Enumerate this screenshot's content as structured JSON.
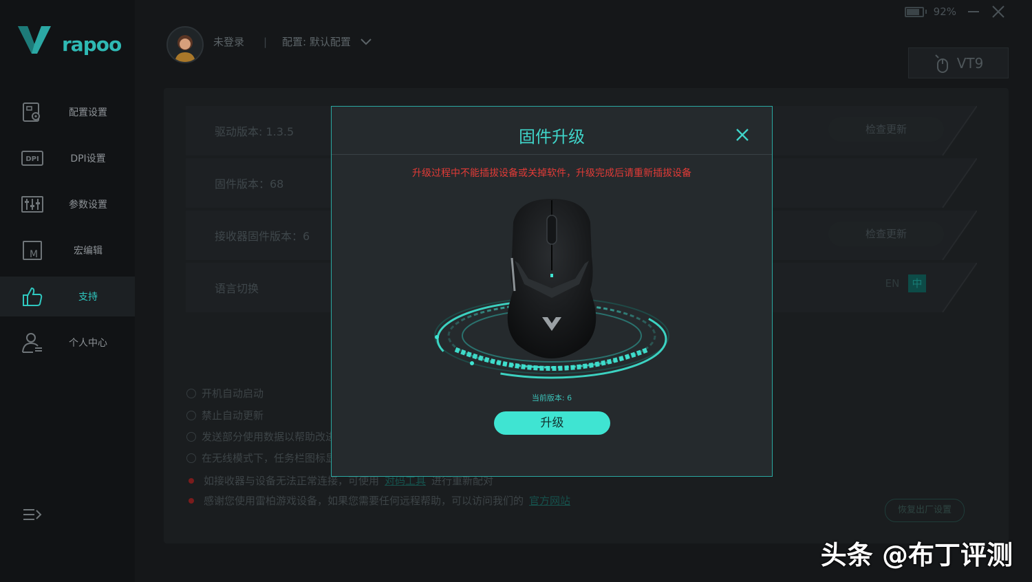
{
  "brand": {
    "logo_text": "rapoo"
  },
  "sidebar": {
    "items": [
      {
        "label": "配置设置",
        "icon": "profile-settings-icon"
      },
      {
        "label": "DPI设置",
        "icon": "dpi-icon"
      },
      {
        "label": "参数设置",
        "icon": "sliders-icon"
      },
      {
        "label": "宏编辑",
        "icon": "macro-icon"
      },
      {
        "label": "支持",
        "icon": "thumbs-up-icon",
        "active": true
      },
      {
        "label": "个人中心",
        "icon": "user-icon"
      }
    ]
  },
  "header": {
    "user": "未登录",
    "separator": "|",
    "profile": "配置: 默认配置",
    "battery": "92%",
    "battery_level": 0.92,
    "device": "VT9"
  },
  "support": {
    "driver_version": "驱动版本: 1.3.5",
    "firmware_version": "固件版本：68",
    "receiver_version": "接收器固件版本：6",
    "language_label": "语言切换",
    "check_update": "检查更新",
    "lang_en": "EN",
    "lang_zh": "中",
    "options": [
      "开机自动启动",
      "禁止自动更新",
      "发送部分使用数据以帮助改进软件",
      "在无线模式下，任务栏图标显示电量"
    ],
    "notes": [
      {
        "text": "如接收器与设备无法正常连接，可使用",
        "link": "对码工具",
        "tail": "进行重新配对"
      },
      {
        "text": "感谢您使用雷柏游戏设备，如果您需要任何远程帮助，可以访问我们的",
        "link": "官方网站",
        "tail": ""
      }
    ],
    "reset": "恢复出厂设置"
  },
  "modal": {
    "title": "固件升级",
    "warning": "升级过程中不能插拔设备或关掉软件，升级完成后请重新插拔设备",
    "current_version": "当前版本: 6",
    "upgrade": "升级"
  },
  "watermark": "头条 @布丁评测",
  "colors": {
    "accent": "#3fe4d2",
    "warning": "#e23b37",
    "bg": "#151719"
  }
}
